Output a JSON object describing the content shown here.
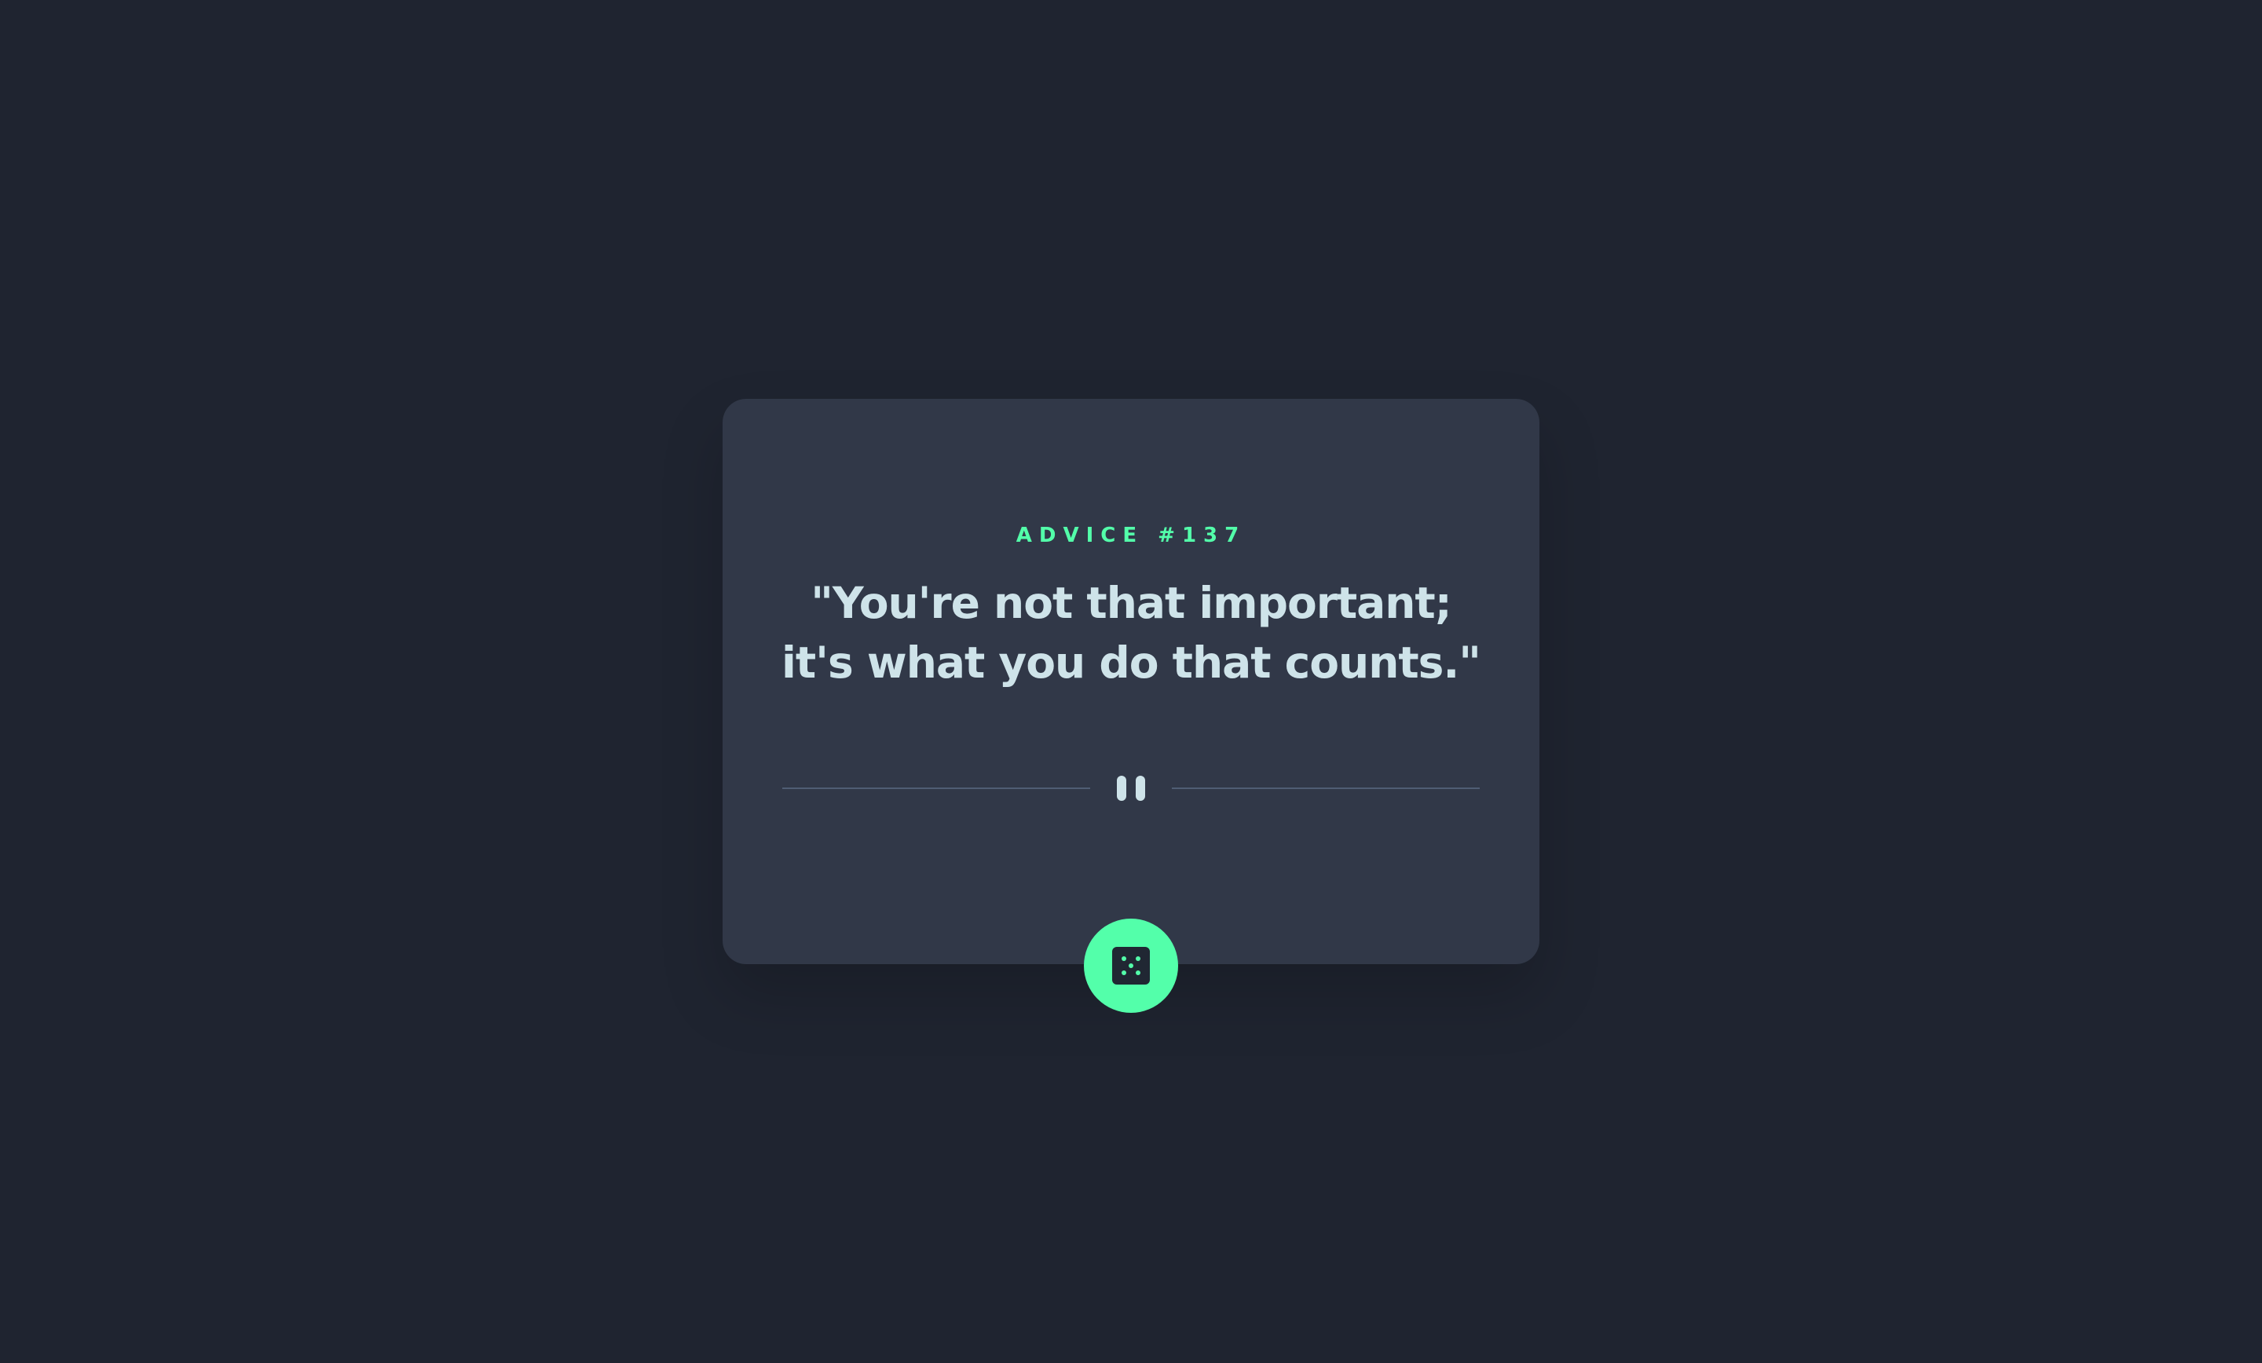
{
  "advice": {
    "id_label": "ADVICE #137",
    "quote": "\"You're not that important; it's what you do that counts.\""
  },
  "icons": {
    "divider": "pause-icon",
    "button": "dice-icon"
  },
  "colors": {
    "background": "#1f2430",
    "card": "#313848",
    "accent": "#53ffaa",
    "text": "#cee3e9",
    "divider": "#4f5d74"
  }
}
